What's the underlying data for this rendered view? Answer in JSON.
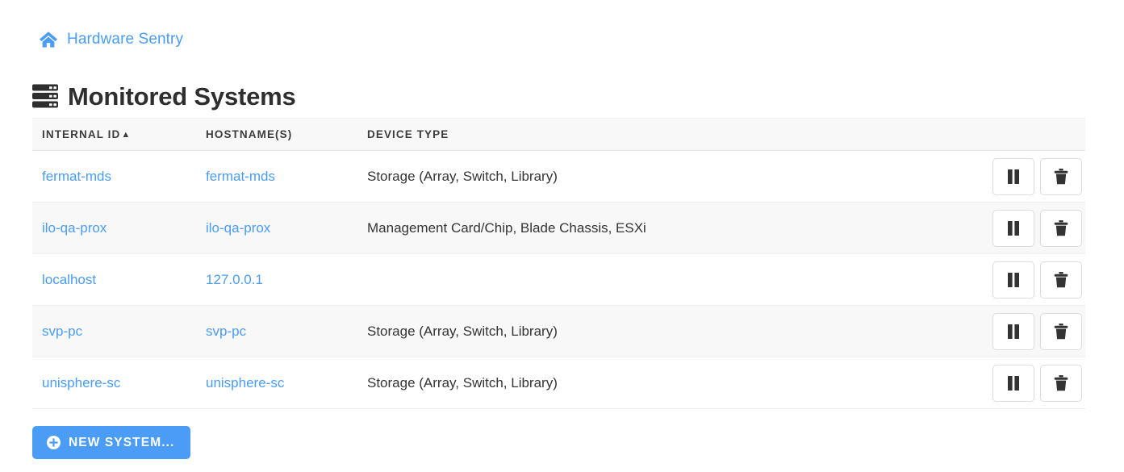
{
  "breadcrumb": {
    "home_icon": "home-icon",
    "link_label": "Hardware Sentry"
  },
  "header": {
    "icon": "server-rack-icon",
    "title": "Monitored Systems"
  },
  "table": {
    "columns": [
      {
        "key": "internal_id",
        "label": "INTERNAL ID",
        "sorted": true,
        "sort_arrow": "▲"
      },
      {
        "key": "hostnames",
        "label": "HOSTNAME(S)",
        "sorted": false,
        "sort_arrow": ""
      },
      {
        "key": "device_type",
        "label": "DEVICE TYPE",
        "sorted": false,
        "sort_arrow": ""
      },
      {
        "key": "actions",
        "label": "",
        "sorted": false,
        "sort_arrow": ""
      }
    ],
    "rows": [
      {
        "internal_id": "fermat-mds",
        "hostnames": "fermat-mds",
        "device_type": "Storage (Array, Switch, Library)",
        "pause_icon": "pause-icon",
        "delete_icon": "trash-icon"
      },
      {
        "internal_id": "ilo-qa-prox",
        "hostnames": "ilo-qa-prox",
        "device_type": "Management Card/Chip, Blade Chassis, ESXi",
        "pause_icon": "pause-icon",
        "delete_icon": "trash-icon"
      },
      {
        "internal_id": "localhost",
        "hostnames": "127.0.0.1",
        "device_type": "",
        "pause_icon": "pause-icon",
        "delete_icon": "trash-icon"
      },
      {
        "internal_id": "svp-pc",
        "hostnames": "svp-pc",
        "device_type": "Storage (Array, Switch, Library)",
        "pause_icon": "pause-icon",
        "delete_icon": "trash-icon"
      },
      {
        "internal_id": "unisphere-sc",
        "hostnames": "unisphere-sc",
        "device_type": "Storage (Array, Switch, Library)",
        "pause_icon": "pause-icon",
        "delete_icon": "trash-icon"
      }
    ]
  },
  "footer": {
    "new_system_label": "New System...",
    "new_system_icon": "plus-circle-icon"
  },
  "colors": {
    "accent": "#4a9cf4",
    "link": "#4a9cf4",
    "title": "#2e2e2e",
    "header_bg": "#f8f8f8",
    "row_alt_bg": "#f8f8f8",
    "border": "#eeeeee",
    "icon_dark": "#333333"
  }
}
